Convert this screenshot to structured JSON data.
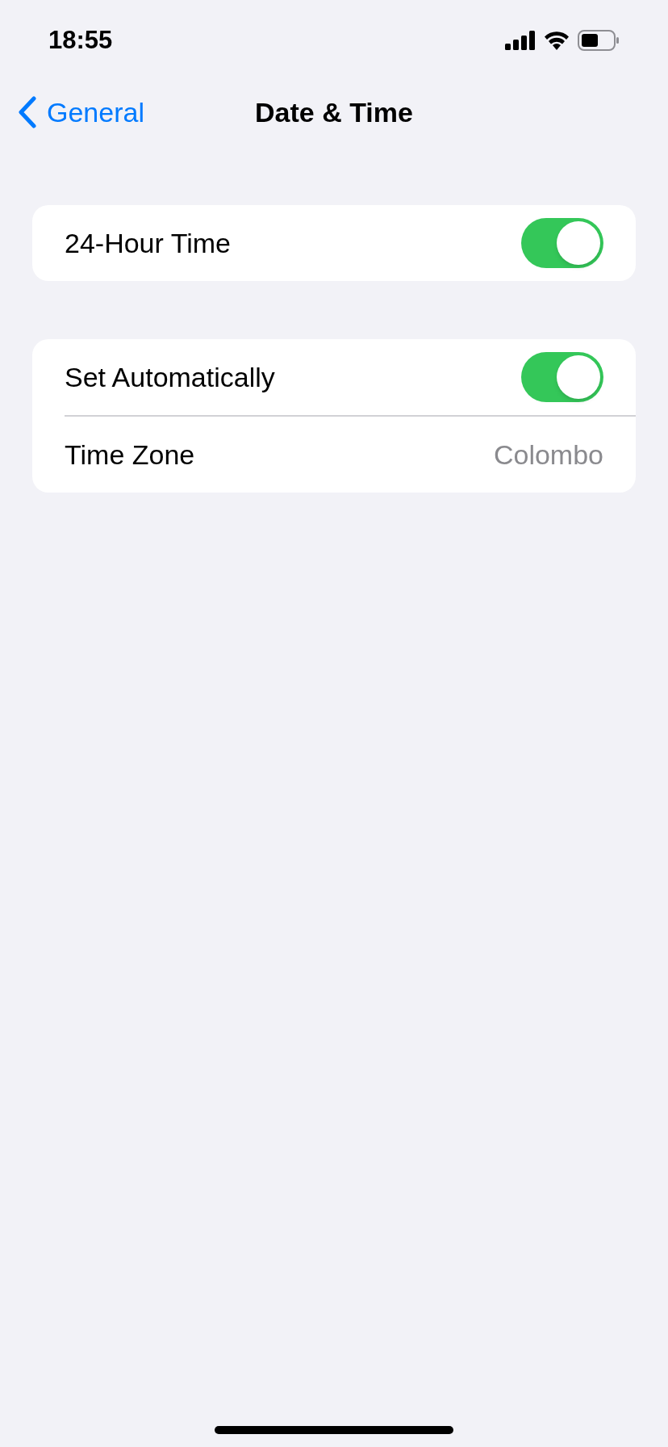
{
  "status_bar": {
    "time": "18:55"
  },
  "nav_bar": {
    "back_label": "General",
    "title": "Date & Time"
  },
  "groups": [
    {
      "rows": [
        {
          "kind": "toggle",
          "label": "24-Hour Time",
          "on": true
        }
      ]
    },
    {
      "rows": [
        {
          "kind": "toggle",
          "label": "Set Automatically",
          "on": true
        },
        {
          "kind": "value",
          "label": "Time Zone",
          "value": "Colombo"
        }
      ]
    }
  ]
}
